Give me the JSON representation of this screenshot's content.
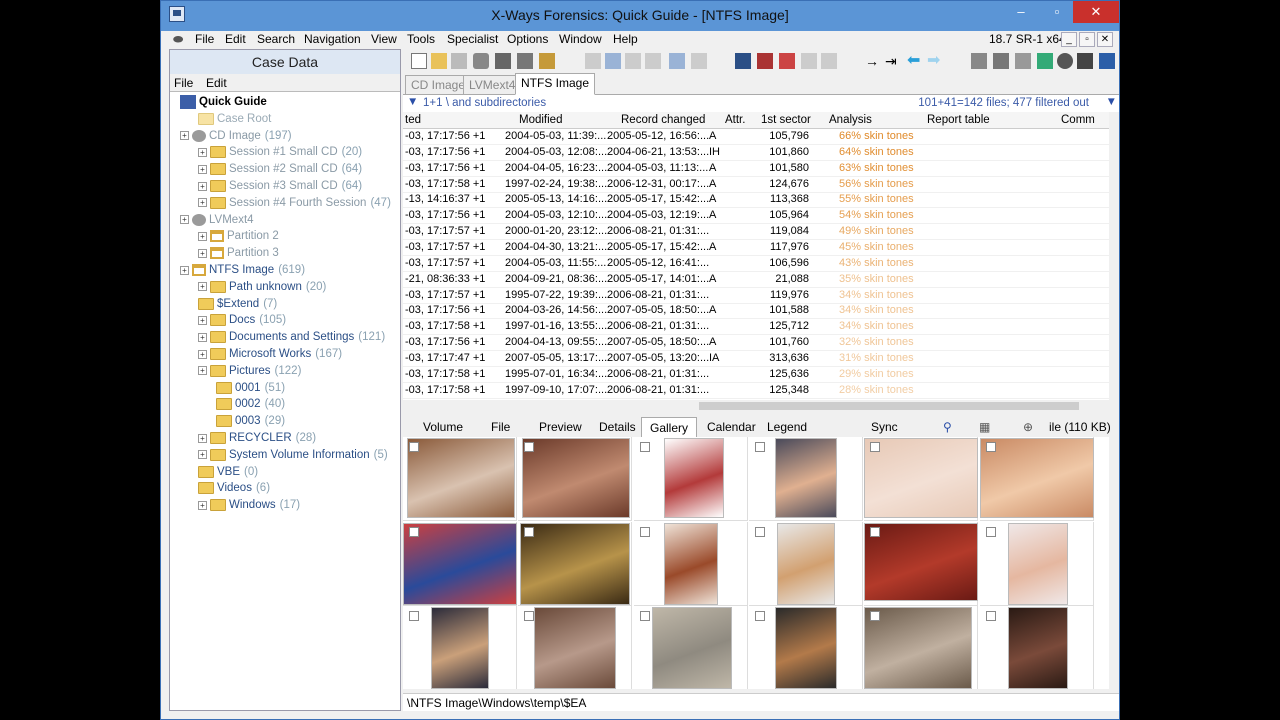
{
  "window": {
    "title": "X-Ways Forensics: Quick Guide - [NTFS Image]",
    "version": "18.7 SR-1 x64"
  },
  "menu": [
    "File",
    "Edit",
    "Search",
    "Navigation",
    "View",
    "Tools",
    "Specialist",
    "Options",
    "Window",
    "Help"
  ],
  "case_pane": {
    "header": "Case Data",
    "menu": [
      "File",
      "Edit"
    ],
    "tree": [
      {
        "label": "Quick Guide",
        "count": ""
      },
      {
        "label": "Case Root",
        "count": ""
      },
      {
        "label": "CD Image",
        "count": "(197)"
      },
      {
        "label": "Session #1 Small CD",
        "count": "(20)"
      },
      {
        "label": "Session #2 Small CD",
        "count": "(64)"
      },
      {
        "label": "Session #3 Small CD",
        "count": "(64)"
      },
      {
        "label": "Session #4 Fourth Session",
        "count": "(47)"
      },
      {
        "label": "LVMext4",
        "count": ""
      },
      {
        "label": "Partition 2",
        "count": ""
      },
      {
        "label": "Partition 3",
        "count": ""
      },
      {
        "label": "NTFS Image",
        "count": "(619)"
      },
      {
        "label": "Path unknown",
        "count": "(20)"
      },
      {
        "label": "$Extend",
        "count": "(7)"
      },
      {
        "label": "Docs",
        "count": "(105)"
      },
      {
        "label": "Documents and Settings",
        "count": "(121)"
      },
      {
        "label": "Microsoft Works",
        "count": "(167)"
      },
      {
        "label": "Pictures",
        "count": "(122)"
      },
      {
        "label": "0001",
        "count": "(51)"
      },
      {
        "label": "0002",
        "count": "(40)"
      },
      {
        "label": "0003",
        "count": "(29)"
      },
      {
        "label": "RECYCLER",
        "count": "(28)"
      },
      {
        "label": "System Volume Information",
        "count": "(5)"
      },
      {
        "label": "VBE",
        "count": "(0)"
      },
      {
        "label": "Videos",
        "count": "(6)"
      },
      {
        "label": "Windows",
        "count": "(17)"
      }
    ]
  },
  "tabs": [
    "CD Image",
    "LVMext4",
    "NTFS Image"
  ],
  "filter": {
    "left": "1+1   \\ and subdirectories",
    "right": "101+41=142 files; 477 filtered out"
  },
  "columns": [
    "ted",
    "Modified",
    "Record changed",
    "Attr.",
    "1st sector",
    "Analysis",
    "Report table",
    "Comm"
  ],
  "rows": [
    [
      "-03, 17:17:56 +1",
      "2004-05-03, 11:39:...",
      "2005-05-12, 16:56:...",
      "A",
      "105,796",
      "66% skin tones"
    ],
    [
      "-03, 17:17:56 +1",
      "2004-05-03, 12:08:...",
      "2004-06-21, 13:53:...",
      "IH",
      "101,860",
      "64% skin tones"
    ],
    [
      "-03, 17:17:56 +1",
      "2004-04-05, 16:23:...",
      "2004-05-03, 11:13:...",
      "A",
      "101,580",
      "63% skin tones"
    ],
    [
      "-03, 17:17:58 +1",
      "1997-02-24, 19:38:...",
      "2006-12-31, 00:17:...",
      "A",
      "124,676",
      "56% skin tones"
    ],
    [
      "-13, 14:16:37 +1",
      "2005-05-13, 14:16:...",
      "2005-05-17, 15:42:...",
      "A",
      "113,368",
      "55% skin tones"
    ],
    [
      "-03, 17:17:56 +1",
      "2004-05-03, 12:10:...",
      "2004-05-03, 12:19:...",
      "A",
      "105,964",
      "54% skin tones"
    ],
    [
      "-03, 17:17:57 +1",
      "2000-01-20, 23:12:...",
      "2006-08-21, 01:31:...",
      "",
      "119,084",
      "49% skin tones"
    ],
    [
      "-03, 17:17:57 +1",
      "2004-04-30, 13:21:...",
      "2005-05-17, 15:42:...",
      "A",
      "117,976",
      "45% skin tones"
    ],
    [
      "-03, 17:17:57 +1",
      "2004-05-03, 11:55:...",
      "2005-05-12, 16:41:...",
      "",
      "106,596",
      "43% skin tones"
    ],
    [
      "-21, 08:36:33 +1",
      "2004-09-21, 08:36:...",
      "2005-05-17, 14:01:...",
      "A",
      "21,088",
      "35% skin tones"
    ],
    [
      "-03, 17:17:57 +1",
      "1995-07-22, 19:39:...",
      "2006-08-21, 01:31:...",
      "",
      "119,976",
      "34% skin tones"
    ],
    [
      "-03, 17:17:56 +1",
      "2004-03-26, 14:56:...",
      "2007-05-05, 18:50:...",
      "A",
      "101,588",
      "34% skin tones"
    ],
    [
      "-03, 17:17:58 +1",
      "1997-01-16, 13:55:...",
      "2006-08-21, 01:31:...",
      "",
      "125,712",
      "34% skin tones"
    ],
    [
      "-03, 17:17:56 +1",
      "2004-04-13, 09:55:...",
      "2007-05-05, 18:50:...",
      "A",
      "101,760",
      "32% skin tones"
    ],
    [
      "-03, 17:17:47 +1",
      "2007-05-05, 13:17:...",
      "2007-05-05, 13:20:...",
      "IA",
      "313,636",
      "31% skin tones"
    ],
    [
      "-03, 17:17:58 +1",
      "1995-07-01, 16:34:...",
      "2006-08-21, 01:31:...",
      "",
      "125,636",
      "29% skin tones"
    ],
    [
      "-03, 17:17:58 +1",
      "1997-09-10, 17:07:...",
      "2006-08-21, 01:31:...",
      "",
      "125,348",
      "28% skin tones"
    ]
  ],
  "view_tabs": [
    "Volume",
    "File",
    "Preview",
    "Details",
    "Gallery",
    "Calendar",
    "Legend",
    "Sync"
  ],
  "view_right": "ile (110 KB)",
  "status": "\\NTFS Image\\Windows\\temp\\$EA",
  "colors": {
    "title_bar": "#5b95d6",
    "close": "#c9302c",
    "skin": "#e08a2a",
    "link": "#3b5ba8"
  }
}
